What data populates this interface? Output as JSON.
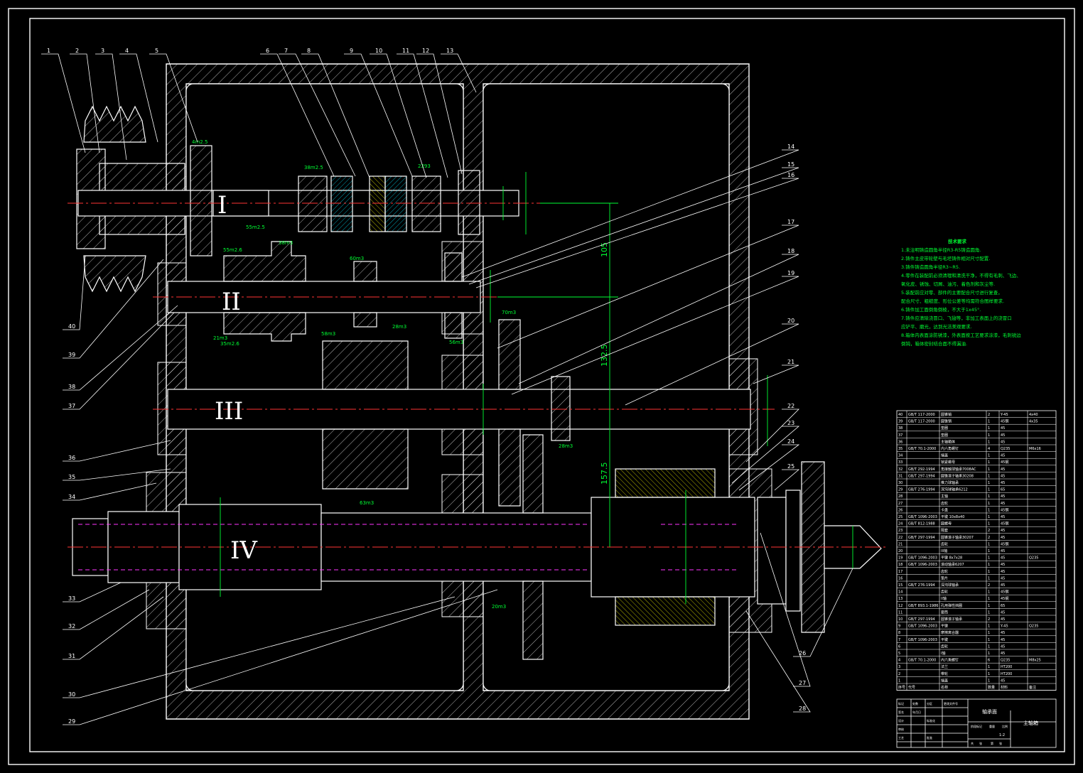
{
  "drawing": {
    "shaft_labels": [
      "I",
      "II",
      "III",
      "IV"
    ],
    "callouts": [
      "1",
      "2",
      "3",
      "4",
      "5",
      "6",
      "7",
      "8",
      "9",
      "10",
      "11",
      "12",
      "13",
      "14",
      "15",
      "16",
      "17",
      "18",
      "19",
      "20",
      "21",
      "22",
      "23",
      "24",
      "25",
      "26",
      "27",
      "28",
      "29",
      "30",
      "31",
      "32",
      "33",
      "34",
      "35",
      "36",
      "37",
      "38",
      "39",
      "40"
    ],
    "dimensions": {
      "d105": "105",
      "d132": "132.5",
      "d157": "157.5"
    },
    "gear_marks": [
      "4m2.5",
      "38m2.5",
      "2293",
      "55m2.5",
      "55m2.6",
      "38m3",
      "60m3",
      "28m3",
      "70m3",
      "58m3",
      "56m3",
      "63m3",
      "35m2.6",
      "28m3",
      "20m3",
      "21m3"
    ],
    "colors": {
      "background": "#000000",
      "outline": "#ffffff",
      "hatch": "#ffffff",
      "dimension": "#00ff33",
      "centerline": "#ff3333",
      "hidden": "#ff33ff",
      "frame": "#ffffff"
    }
  },
  "notes": {
    "title": "技术要求",
    "lines": [
      "1.未注明铸造圆角半径R3-R5铸造圆角.",
      "2.铸件主皮带轮壁与毛坯铸件相对尺寸配置.",
      "3.铸件铸造圆角半径R3~R5.",
      "4.零件在装配前必须清理和清洗干净，不得有毛刺、飞边、",
      "氧化皮、锈蚀、切屑、油污、着色剂和灰尘等.",
      "5.装配前应对零、部件的主要配合尺寸进行复查，",
      "配合尺寸、粗糙度、形位公差等均需符合图样要求.",
      "6.铸件加工面倒角倒棱，不大于1x45°.",
      "7.铸件应清除浇冒口、飞翅等，非加工表面上的浇冒口",
      "应铲平、磨光，达到光洁美观要求.",
      "8.箱体内表面涂防锈漆，外表面按工艺要求涂漆，毛刺锐边",
      "倒钝，箱体密封结合面不得漏油."
    ]
  },
  "title_block": {
    "company_cell": "轴承面",
    "drawing_name": "主轴箱",
    "labels": [
      "标记",
      "处数",
      "分区",
      "更改文件号",
      "签名",
      "年月日",
      "设计",
      "标准化",
      "阶段标记",
      "重量",
      "比例",
      "审核",
      "工艺",
      "批准",
      "共",
      "张",
      "第",
      "张"
    ],
    "scale": "1:2"
  },
  "bom": {
    "rows": [
      {
        "no": "40",
        "std": "GB/T 117-2000",
        "name": "圆锥销",
        "qty": "2",
        "mat": "Y-45",
        "note": "4x40"
      },
      {
        "no": "39",
        "std": "GB/T 117-2000",
        "name": "圆锥销",
        "qty": "1",
        "mat": "45钢",
        "note": "4x35"
      },
      {
        "no": "38",
        "std": "",
        "name": "垫圈",
        "qty": "1",
        "mat": "45",
        "note": ""
      },
      {
        "no": "37",
        "std": "",
        "name": "垫圈",
        "qty": "1",
        "mat": "45",
        "note": ""
      },
      {
        "no": "36",
        "std": "",
        "name": "主轴箱体",
        "qty": "1",
        "mat": "45",
        "note": ""
      },
      {
        "no": "35",
        "std": "GB/T 70.1-2000",
        "name": "内六角螺钉",
        "qty": "4",
        "mat": "Q235",
        "note": "M6x16"
      },
      {
        "no": "34",
        "std": "",
        "name": "端盖",
        "qty": "1",
        "mat": "45",
        "note": ""
      },
      {
        "no": "33",
        "std": "",
        "name": "锁紧螺母",
        "qty": "1",
        "mat": "45钢",
        "note": ""
      },
      {
        "no": "32",
        "std": "GB/T 292-1994",
        "name": "角接触球轴承7008AC",
        "qty": "1",
        "mat": "45",
        "note": ""
      },
      {
        "no": "31",
        "std": "GB/T 297-1994",
        "name": "圆锥滚子轴承30208",
        "qty": "1",
        "mat": "45",
        "note": ""
      },
      {
        "no": "30",
        "std": "",
        "name": "推力球轴承",
        "qty": "1",
        "mat": "45",
        "note": ""
      },
      {
        "no": "29",
        "std": "GB/T 276-1994",
        "name": "深沟球轴承6212",
        "qty": "1",
        "mat": "65",
        "note": ""
      },
      {
        "no": "28",
        "std": "",
        "name": "主轴",
        "qty": "1",
        "mat": "45",
        "note": ""
      },
      {
        "no": "27",
        "std": "",
        "name": "齿轮",
        "qty": "1",
        "mat": "45",
        "note": ""
      },
      {
        "no": "26",
        "std": "",
        "name": "卡盘",
        "qty": "1",
        "mat": "45钢",
        "note": ""
      },
      {
        "no": "25",
        "std": "GB/T 1096-2003",
        "name": "平键 10x8x40",
        "qty": "1",
        "mat": "45",
        "note": ""
      },
      {
        "no": "24",
        "std": "GB/T 812-1988",
        "name": "圆螺母",
        "qty": "1",
        "mat": "45钢",
        "note": ""
      },
      {
        "no": "23",
        "std": "",
        "name": "隔套",
        "qty": "2",
        "mat": "45",
        "note": ""
      },
      {
        "no": "22",
        "std": "GB/T 297-1994",
        "name": "圆锥滚子轴承30207",
        "qty": "2",
        "mat": "45",
        "note": ""
      },
      {
        "no": "21",
        "std": "",
        "name": "齿轮",
        "qty": "1",
        "mat": "45钢",
        "note": ""
      },
      {
        "no": "20",
        "std": "",
        "name": "III轴",
        "qty": "1",
        "mat": "45",
        "note": ""
      },
      {
        "no": "19",
        "std": "GB/T 1096-2003",
        "name": "平键 8x7x28",
        "qty": "1",
        "mat": "45",
        "note": "Q235"
      },
      {
        "no": "18",
        "std": "GB/T 1096-2003",
        "name": "滚动轴承6207",
        "qty": "1",
        "mat": "45",
        "note": ""
      },
      {
        "no": "17",
        "std": "",
        "name": "齿轮",
        "qty": "1",
        "mat": "45",
        "note": ""
      },
      {
        "no": "16",
        "std": "",
        "name": "垫片",
        "qty": "1",
        "mat": "45",
        "note": ""
      },
      {
        "no": "15",
        "std": "GB/T 276-1994",
        "name": "深沟球轴承",
        "qty": "2",
        "mat": "45",
        "note": ""
      },
      {
        "no": "14",
        "std": "",
        "name": "齿轮",
        "qty": "1",
        "mat": "45钢",
        "note": ""
      },
      {
        "no": "13",
        "std": "",
        "name": "II轴",
        "qty": "1",
        "mat": "45钢",
        "note": ""
      },
      {
        "no": "12",
        "std": "GB/T 893.1-1986",
        "name": "孔用弹性挡圈",
        "qty": "1",
        "mat": "65",
        "note": ""
      },
      {
        "no": "11",
        "std": "",
        "name": "套筒",
        "qty": "1",
        "mat": "45",
        "note": ""
      },
      {
        "no": "10",
        "std": "GB/T 297-1994",
        "name": "圆锥滚子轴承",
        "qty": "2",
        "mat": "45",
        "note": ""
      },
      {
        "no": "9",
        "std": "GB/T 1096-2003",
        "name": "平键",
        "qty": "1",
        "mat": "Y-45",
        "note": "Q235"
      },
      {
        "no": "8",
        "std": "",
        "name": "摩擦离合器",
        "qty": "1",
        "mat": "45",
        "note": ""
      },
      {
        "no": "7",
        "std": "GB/T 1096-2003",
        "name": "平键",
        "qty": "1",
        "mat": "45",
        "note": ""
      },
      {
        "no": "6",
        "std": "",
        "name": "齿轮",
        "qty": "1",
        "mat": "45",
        "note": ""
      },
      {
        "no": "5",
        "std": "",
        "name": "I轴",
        "qty": "1",
        "mat": "45",
        "note": ""
      },
      {
        "no": "4",
        "std": "GB/T 70.1-2000",
        "name": "内六角螺钉",
        "qty": "6",
        "mat": "Q235",
        "note": "M8x25"
      },
      {
        "no": "3",
        "std": "",
        "name": "法兰",
        "qty": "1",
        "mat": "HT200",
        "note": ""
      },
      {
        "no": "2",
        "std": "",
        "name": "带轮",
        "qty": "1",
        "mat": "HT200",
        "note": ""
      },
      {
        "no": "1",
        "std": "",
        "name": "端盖",
        "qty": "1",
        "mat": "45",
        "note": ""
      }
    ],
    "header": {
      "no": "序号",
      "std": "代号",
      "name": "名称",
      "qty": "数量",
      "mat": "材料",
      "note": "备注"
    }
  }
}
